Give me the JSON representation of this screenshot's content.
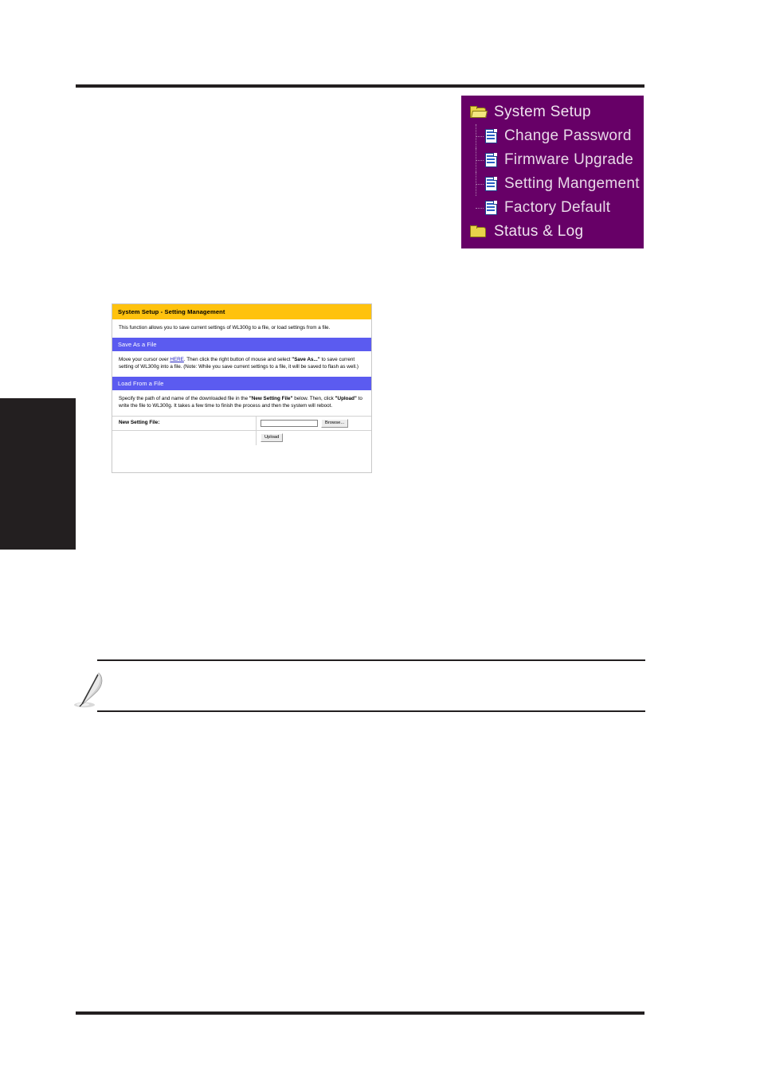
{
  "page": {
    "edge_tab_name": "chapter-edge-tab"
  },
  "nav_menu": {
    "items": [
      {
        "label": "System Setup",
        "icon": "folder-open-icon",
        "level": "root"
      },
      {
        "label": "Change Password",
        "icon": "document-icon",
        "level": "child"
      },
      {
        "label": "Firmware Upgrade",
        "icon": "document-icon",
        "level": "child"
      },
      {
        "label": "Setting Mangement",
        "icon": "document-icon",
        "level": "child"
      },
      {
        "label": "Factory Default",
        "icon": "document-icon",
        "level": "child"
      },
      {
        "label": "Status & Log",
        "icon": "folder-icon",
        "level": "root"
      }
    ],
    "background_color": "#670067",
    "text_color": "#e8d9e8"
  },
  "web_panel": {
    "title": "System Setup - Setting Management",
    "title_bg": "#ffc20e",
    "intro": "This function allows you to save current settings of WL300g to a file, or load settings from a file.",
    "section_save": {
      "heading": "Save As a File",
      "heading_bg": "#5b5bf0",
      "text_1": "Move your cursor over ",
      "link": "HERE",
      "text_2": ". Then click the right button of mouse and select ",
      "bold_1": "\"Save As...\"",
      "text_3": " to save current setting of WL300g into a file. (Note: While you save current settings to a file, it will be saved to flash as well.)"
    },
    "section_load": {
      "heading": "Load From a File",
      "heading_bg": "#5b5bf0",
      "text_1": "Specify the path of and name of the downloaded file in the ",
      "bold_1": "\"New Setting File\"",
      "text_2": " below. Then, click ",
      "bold_2": "\"Upload\"",
      "text_3": " to write the file to WL300g. It takes a few time to finish the process and then the system will reboot.",
      "field_label": "New Setting File:",
      "field_value": "",
      "browse_label": "Browse...",
      "upload_label": "Upload"
    }
  },
  "note": {
    "icon": "pencil-note-icon",
    "text": ""
  }
}
